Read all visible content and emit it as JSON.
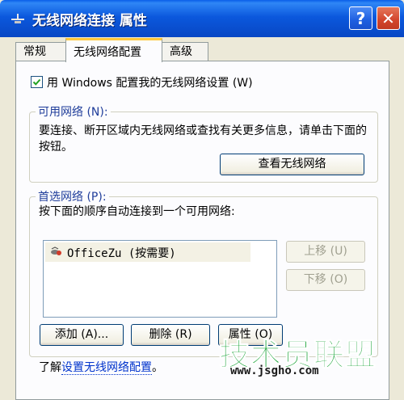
{
  "window": {
    "title": "无线网络连接 属性",
    "help_label": "?",
    "close_label": "✕"
  },
  "tabs": [
    {
      "label": "常规",
      "active": false
    },
    {
      "label": "无线网络配置",
      "active": true
    },
    {
      "label": "高级",
      "active": false
    }
  ],
  "settings": {
    "use_windows_label": "用 Windows 配置我的无线网络设置 (W)",
    "use_windows_checked": true
  },
  "available": {
    "legend": "可用网络 (N):",
    "description": "要连接、断开区域内无线网络或查找有关更多信息，请单击下面的按钮。",
    "view_button": "查看无线网络"
  },
  "preferred": {
    "legend": "首选网络 (P):",
    "description": "按下面的顺序自动连接到一个可用网络:",
    "networks": [
      {
        "name": "OfficeZu (按需要)"
      }
    ],
    "move_up": "上移 (U)",
    "move_down": "下移 (O)",
    "add": "添加 (A)...",
    "remove": "删除 (R)",
    "properties": "属性 (O)"
  },
  "footer": {
    "prefix": "了解",
    "link": "设置无线网络配置",
    "suffix": "。"
  },
  "watermark": {
    "text": "技术员联盟",
    "url": "www.jsgho.com"
  },
  "colors": {
    "titlebar": "#0B58DD",
    "dialog_bg": "#ECE9D8",
    "panel_bg": "#FCFCFE",
    "legend_text": "#1F3D9A",
    "active_tab_accent": "#FFC83C",
    "link": "#0033CC",
    "watermark": "#1CA43A"
  },
  "icons": [
    "network-connection-icon",
    "help-icon",
    "close-icon",
    "checkmark-icon",
    "wireless-network-icon"
  ]
}
